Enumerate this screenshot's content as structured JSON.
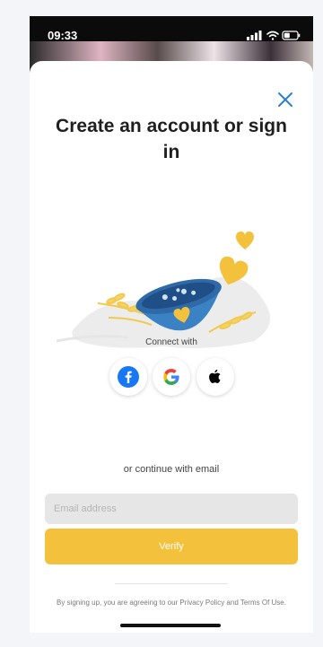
{
  "status_bar": {
    "time": "09:33"
  },
  "modal": {
    "title": "Create an account or sign in",
    "connect_label": "Connect with",
    "social": [
      {
        "name": "facebook",
        "icon": "facebook-icon",
        "color": "#1877F2"
      },
      {
        "name": "google",
        "icon": "google-icon"
      },
      {
        "name": "apple",
        "icon": "apple-icon",
        "color": "#000000"
      }
    ],
    "email_divider": "or continue with email",
    "email_placeholder": "Email address",
    "email_value": "",
    "verify_label": "Verify",
    "terms": "By signing up, you are agreeing to our Privacy Policy and Terms Of Use."
  },
  "colors": {
    "accent": "#F4C13D",
    "input_bg": "#E6E6E6",
    "bowl_blue": "#3B82C4"
  }
}
